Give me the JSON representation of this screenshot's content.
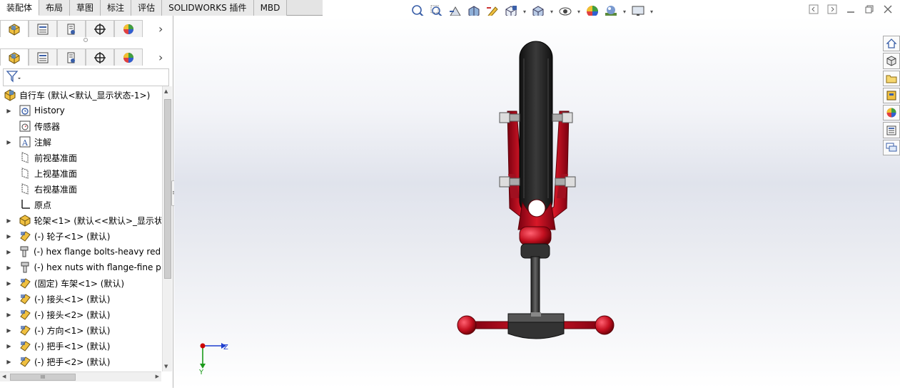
{
  "tabs": [
    "装配体",
    "布局",
    "草图",
    "标注",
    "评估",
    "SOLIDWORKS 插件",
    "MBD"
  ],
  "active_tab": "装配体",
  "tree": {
    "root": "自行车  (默认<默认_显示状态-1>)",
    "items": [
      {
        "label": "History",
        "icon": "history-icon",
        "expandable": true
      },
      {
        "label": "传感器",
        "icon": "sensor-icon",
        "expandable": false
      },
      {
        "label": "注解",
        "icon": "annotation-icon",
        "expandable": true
      },
      {
        "label": "前视基准面",
        "icon": "plane-icon",
        "expandable": false
      },
      {
        "label": "上视基准面",
        "icon": "plane-icon",
        "expandable": false
      },
      {
        "label": "右视基准面",
        "icon": "plane-icon",
        "expandable": false
      },
      {
        "label": "原点",
        "icon": "origin-icon",
        "expandable": false
      },
      {
        "label": "轮架<1> (默认<<默认>_显示状",
        "icon": "subassembly-icon",
        "expandable": true
      },
      {
        "label": "(-) 轮子<1> (默认)",
        "icon": "part-icon",
        "expandable": true
      },
      {
        "label": "(-) hex flange bolts-heavy redu",
        "icon": "bolt-icon",
        "expandable": true
      },
      {
        "label": "(-) hex nuts with flange-fine pi",
        "icon": "bolt-icon",
        "expandable": true
      },
      {
        "label": "(固定) 车架<1> (默认)",
        "icon": "part-icon",
        "expandable": true
      },
      {
        "label": "(-) 接头<1> (默认)",
        "icon": "part-icon",
        "expandable": true
      },
      {
        "label": "(-) 接头<2> (默认)",
        "icon": "part-icon",
        "expandable": true
      },
      {
        "label": "(-) 方向<1> (默认)",
        "icon": "part-icon",
        "expandable": true
      },
      {
        "label": "(-) 把手<1> (默认)",
        "icon": "part-icon",
        "expandable": true
      },
      {
        "label": "(-) 把手<2> (默认)",
        "icon": "part-icon",
        "expandable": true
      }
    ]
  },
  "scrollbar_thumb_label": "III",
  "splitter_label": "≡",
  "triad": {
    "z_label": "Z",
    "y_label": "Y"
  },
  "colors": {
    "frame_red": "#c41020",
    "tire_black": "#2a2a2a",
    "axis_red": "#cc0000",
    "axis_blue": "#1f3fd0",
    "axis_green": "#1a9a1a"
  }
}
